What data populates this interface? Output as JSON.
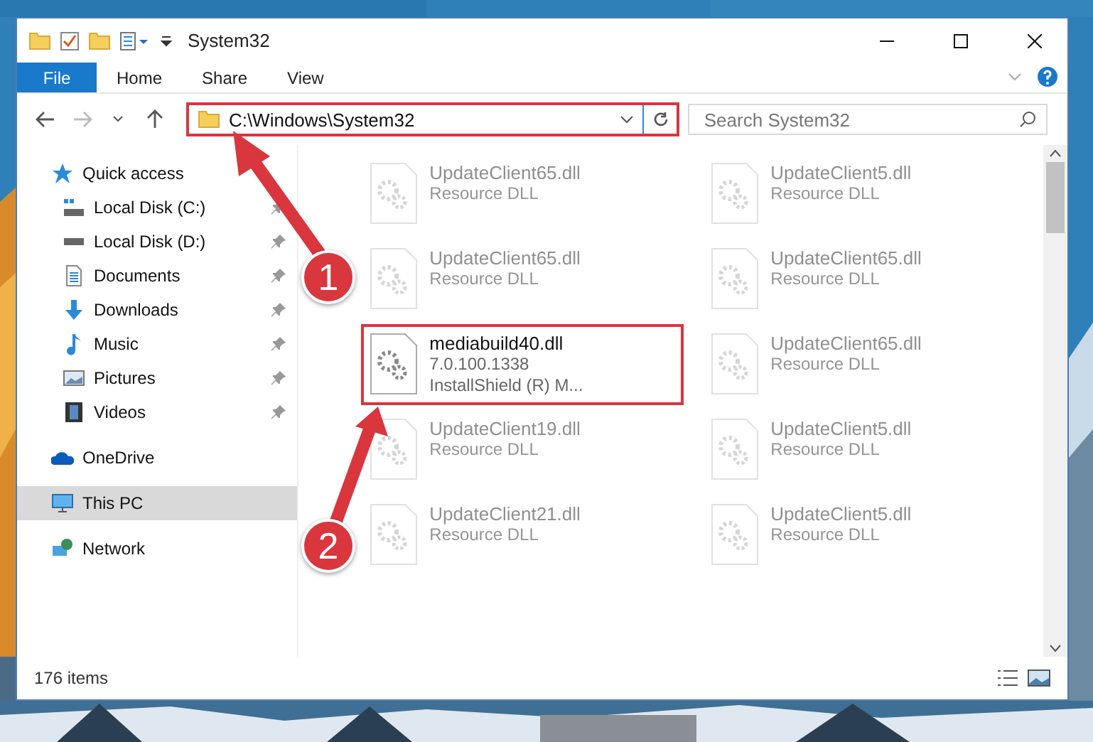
{
  "window": {
    "title": "System32"
  },
  "ribbon_tabs": [
    {
      "label": "File",
      "selected": true
    },
    {
      "label": "Home",
      "selected": false
    },
    {
      "label": "Share",
      "selected": false
    },
    {
      "label": "View",
      "selected": false
    }
  ],
  "address": {
    "path": "C:\\Windows\\System32",
    "highlighted": true
  },
  "search": {
    "placeholder": "Search System32"
  },
  "sidebar": [
    {
      "label": "Quick access",
      "kind": "star",
      "selected": false,
      "children": [
        {
          "label": "Local Disk (C:)",
          "kind": "system-drive",
          "pinned": true,
          "selected": false
        },
        {
          "label": "Local Disk (D:)",
          "kind": "drive",
          "pinned": true,
          "selected": false
        },
        {
          "label": "Documents",
          "kind": "documents",
          "pinned": true,
          "selected": false
        },
        {
          "label": "Downloads",
          "kind": "downloads",
          "pinned": true,
          "selected": false
        },
        {
          "label": "Music",
          "kind": "music",
          "pinned": true,
          "selected": false
        },
        {
          "label": "Pictures",
          "kind": "pictures",
          "pinned": true,
          "selected": false
        },
        {
          "label": "Videos",
          "kind": "videos",
          "pinned": true,
          "selected": false
        }
      ]
    },
    {
      "label": "OneDrive",
      "kind": "cloud",
      "selected": false
    },
    {
      "label": "This PC",
      "kind": "computer",
      "selected": true
    },
    {
      "label": "Network",
      "kind": "network",
      "selected": false
    }
  ],
  "files": [
    {
      "name": "UpdateClient65.dll",
      "details": [
        "Resource DLL"
      ],
      "dimmed": true,
      "highlighted": false
    },
    {
      "name": "UpdateClient65.dll",
      "details": [
        "Resource DLL"
      ],
      "dimmed": true,
      "highlighted": false
    },
    {
      "name": "mediabuild40.dll",
      "details": [
        "7.0.100.1338",
        "InstallShield (R) M..."
      ],
      "dimmed": false,
      "highlighted": true
    },
    {
      "name": "UpdateClient19.dll",
      "details": [
        "Resource DLL"
      ],
      "dimmed": true,
      "highlighted": false
    },
    {
      "name": "UpdateClient21.dll",
      "details": [
        "Resource DLL"
      ],
      "dimmed": true,
      "highlighted": false
    },
    {
      "name": "UpdateClient5.dll",
      "details": [
        "Resource DLL"
      ],
      "dimmed": true,
      "highlighted": false
    },
    {
      "name": "UpdateClient65.dll",
      "details": [
        "Resource DLL"
      ],
      "dimmed": true,
      "highlighted": false
    },
    {
      "name": "UpdateClient65.dll",
      "details": [
        "Resource DLL"
      ],
      "dimmed": true,
      "highlighted": false
    },
    {
      "name": "UpdateClient5.dll",
      "details": [
        "Resource DLL"
      ],
      "dimmed": true,
      "highlighted": false
    },
    {
      "name": "UpdateClient5.dll",
      "details": [
        "Resource DLL"
      ],
      "dimmed": true,
      "highlighted": false
    }
  ],
  "status_bar": {
    "count": "176 items"
  },
  "annotations": [
    {
      "number": "1"
    },
    {
      "number": "2"
    }
  ]
}
